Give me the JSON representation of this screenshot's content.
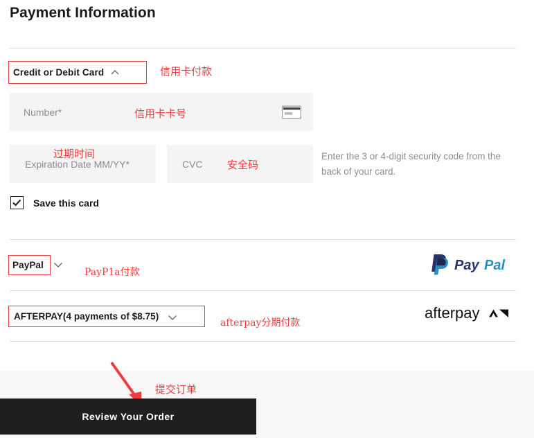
{
  "header": {
    "title": "Payment Information"
  },
  "credit_card": {
    "method_label": "Credit or Debit Card",
    "method_chevron_icon": "chevron-up-icon",
    "annotation": "信用卡付款",
    "number_placeholder": "Number*",
    "number_annotation": "信用卡卡号",
    "card_icon": "credit-card-icon",
    "expiration_placeholder": "Expiration Date MM/YY*",
    "expiration_annotation": "过期时间",
    "cvc_placeholder": "CVC",
    "cvc_annotation": "安全码",
    "cvc_help": "Enter the 3 or 4-digit security code from the back of your card.",
    "save_card_label": "Save this card",
    "save_card_checked": true,
    "check_icon": "check-icon"
  },
  "paypal": {
    "method_label": "PayPal",
    "chevron_icon": "chevron-down-icon",
    "annotation": "PayP1a付款",
    "logo_alt": "paypal-logo"
  },
  "afterpay": {
    "method_label": "AFTERPAY(4 payments of $8.75)",
    "chevron_icon": "chevron-down-icon",
    "annotation": "afterpay分期付款",
    "logo_alt": "afterpay-logo"
  },
  "footer": {
    "review_button_label": "Review Your Order",
    "review_annotation": "提交订单",
    "arrow_icon": "red-arrow-icon"
  },
  "colors": {
    "annotation_red": "#f03c3c",
    "highlight_red": "#ef3c3c",
    "button_dark": "#1f1f1f",
    "field_gray": "#f4f4f4",
    "footer_gray": "#f7f7f7",
    "placeholder_gray": "#8d8d8d",
    "divider_gray": "#dcdcdc"
  }
}
